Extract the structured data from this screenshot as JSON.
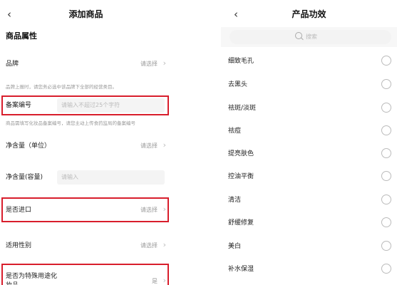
{
  "left": {
    "title": "添加商品",
    "back_icon": "‹",
    "section_title": "商品属性",
    "brand": {
      "label": "品牌",
      "value": "请选择"
    },
    "brand_hint": "品牌上报时，请您务必选中该品牌下全部的经营类目。",
    "record": {
      "label": "备案编号",
      "placeholder": "请输入不超过25个字符"
    },
    "record_hint": "商品需填写化妆品备案编号，请您主动上传食药监局的备案编号",
    "net_unit": {
      "label": "净含量（单位）",
      "value": "请选择"
    },
    "net_capacity": {
      "label": "净含量(容量)",
      "placeholder": "请输入"
    },
    "imported": {
      "label": "是否进口",
      "value": "请选择"
    },
    "gender": {
      "label": "适用性别",
      "value": "请选择"
    },
    "special_use": {
      "label": "是否为特殊用途化",
      "label2": "妆品",
      "value": "是"
    },
    "chevron": "›",
    "highlight_color": "#d81e2c"
  },
  "right": {
    "title": "产品功效",
    "back_icon": "‹",
    "search_placeholder": "搜索",
    "effects": [
      "细致毛孔",
      "去黑头",
      "祛斑/淡斑",
      "祛痘",
      "提亮肤色",
      "控油平衡",
      "清洁",
      "舒缓修复",
      "美白",
      "补水保湿"
    ]
  }
}
